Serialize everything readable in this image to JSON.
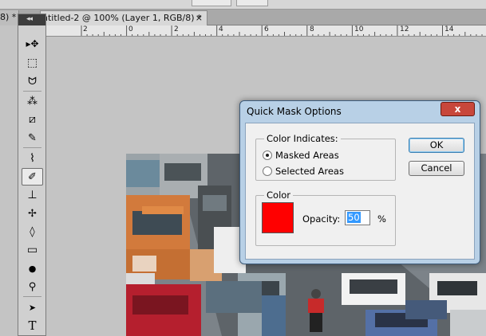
{
  "document": {
    "inactive_tab_label": "8) *",
    "active_tab_label": "ntitled-2 @ 100% (Layer 1, RGB/8) *",
    "close_glyph": "×",
    "panel_collapse_glyph": "◂◂"
  },
  "ruler": {
    "ticks": [
      "2",
      "0",
      "2",
      "4",
      "6",
      "8",
      "10",
      "12",
      "14"
    ]
  },
  "tools": [
    {
      "name": "move-tool-icon",
      "glyph": "▸✥"
    },
    {
      "name": "marquee-tool-icon",
      "glyph": "⬚"
    },
    {
      "name": "lasso-tool-icon",
      "glyph": "ᗢ"
    },
    {
      "name": "magic-wand-tool-icon",
      "glyph": "⁂"
    },
    {
      "name": "crop-tool-icon",
      "glyph": "⧄"
    },
    {
      "name": "eyedropper-tool-icon",
      "glyph": "✎"
    },
    {
      "name": "healing-brush-tool-icon",
      "glyph": "⌇"
    },
    {
      "name": "brush-tool-icon",
      "glyph": "✐"
    },
    {
      "name": "clone-stamp-tool-icon",
      "glyph": "⊥"
    },
    {
      "name": "history-brush-tool-icon",
      "glyph": "✢"
    },
    {
      "name": "eraser-tool-icon",
      "glyph": "◊"
    },
    {
      "name": "gradient-tool-icon",
      "glyph": "▭"
    },
    {
      "name": "blur-tool-icon",
      "glyph": "●"
    },
    {
      "name": "dodge-tool-icon",
      "glyph": "⚲"
    },
    {
      "name": "path-selection-tool-icon",
      "glyph": "➤"
    },
    {
      "name": "type-tool-icon",
      "glyph": "T"
    }
  ],
  "dialog": {
    "title": "Quick Mask Options",
    "close_glyph": "x",
    "color_indicates": {
      "legend": "Color Indicates:",
      "options": [
        {
          "label": "Masked Areas",
          "checked": true
        },
        {
          "label": "Selected Areas",
          "checked": false
        }
      ]
    },
    "color_group": {
      "legend": "Color",
      "swatch_color": "#ff0000",
      "opacity_label": "Opacity:",
      "opacity_value": "50",
      "opacity_unit": "%"
    },
    "buttons": {
      "ok": "OK",
      "cancel": "Cancel"
    }
  }
}
